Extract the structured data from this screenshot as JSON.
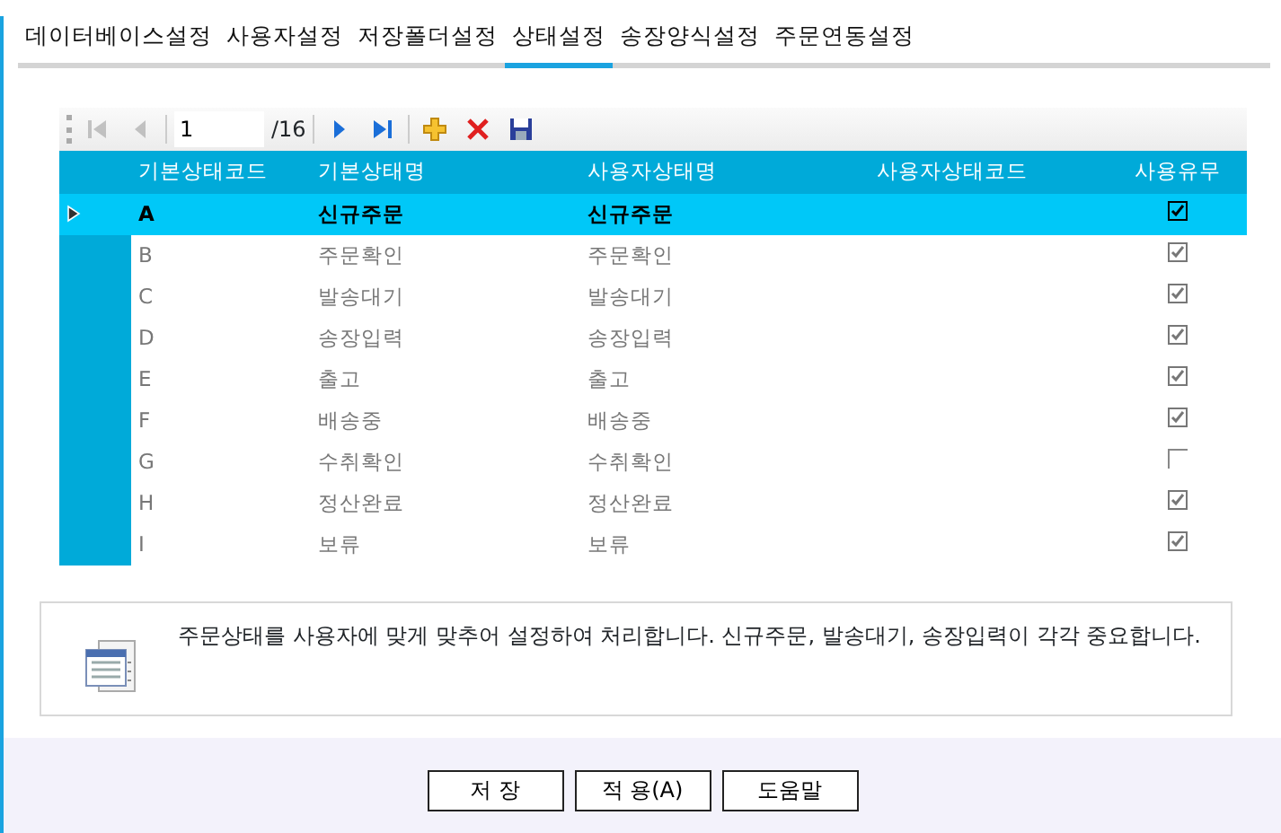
{
  "tabs": [
    {
      "label": "데이터베이스설정",
      "selected": false
    },
    {
      "label": "사용자설정",
      "selected": false
    },
    {
      "label": "저장폴더설정",
      "selected": false
    },
    {
      "label": "상태설정",
      "selected": true
    },
    {
      "label": "송장양식설정",
      "selected": false
    },
    {
      "label": "주문연동설정",
      "selected": false
    }
  ],
  "navigator": {
    "page": "1",
    "total": "/16",
    "first_disabled": true,
    "prev_disabled": true
  },
  "grid": {
    "columns": [
      "기본상태코드",
      "기본상태명",
      "사용자상태명",
      "사용자상태코드",
      "사용유무"
    ],
    "rows": [
      {
        "code": "A",
        "base_name": "신규주문",
        "user_name": "신규주문",
        "used": true,
        "selected": true
      },
      {
        "code": "B",
        "base_name": "주문확인",
        "user_name": "주문확인",
        "used": true,
        "selected": false
      },
      {
        "code": "C",
        "base_name": "발송대기",
        "user_name": "발송대기",
        "used": true,
        "selected": false
      },
      {
        "code": "D",
        "base_name": "송장입력",
        "user_name": "송장입력",
        "used": true,
        "selected": false
      },
      {
        "code": "E",
        "base_name": "출고",
        "user_name": "출고",
        "used": true,
        "selected": false
      },
      {
        "code": "F",
        "base_name": "배송중",
        "user_name": "배송중",
        "used": true,
        "selected": false
      },
      {
        "code": "G",
        "base_name": "수취확인",
        "user_name": "수취확인",
        "used": false,
        "selected": false
      },
      {
        "code": "H",
        "base_name": "정산완료",
        "user_name": "정산완료",
        "used": true,
        "selected": false
      },
      {
        "code": "I",
        "base_name": "보류",
        "user_name": "보류",
        "used": true,
        "selected": false
      }
    ]
  },
  "info": "주문상태를 사용자에 맞게 맞추어 설정하여 처리합니다.  신규주문, 발송대기, 송장입력이 각각 중요합니다.",
  "buttons": [
    "저 장",
    "적 용(A)",
    "도움말"
  ]
}
